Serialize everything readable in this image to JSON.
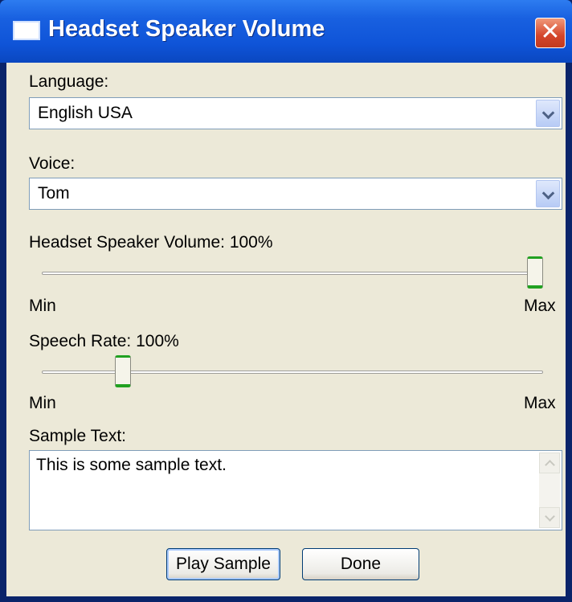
{
  "window": {
    "title": "Headset Speaker Volume",
    "close_label": "✕"
  },
  "language": {
    "label": "Language:",
    "selected": "English USA"
  },
  "voice": {
    "label": "Voice:",
    "selected": "Tom"
  },
  "volume": {
    "label": "Headset Speaker Volume:  100%",
    "value_percent": 100,
    "min_label": "Min",
    "max_label": "Max"
  },
  "speech_rate": {
    "label": "Speech Rate:  100%",
    "value_fraction": 0.15,
    "min_label": "Min",
    "max_label": "Max"
  },
  "sample_text": {
    "label": "Sample Text:",
    "value": "This is some sample text."
  },
  "buttons": {
    "play_sample": "Play Sample",
    "done": "Done"
  },
  "colors": {
    "title_bar": "#1860e0",
    "client_bg": "#ece9d8",
    "thumb_accent": "#21a121"
  }
}
